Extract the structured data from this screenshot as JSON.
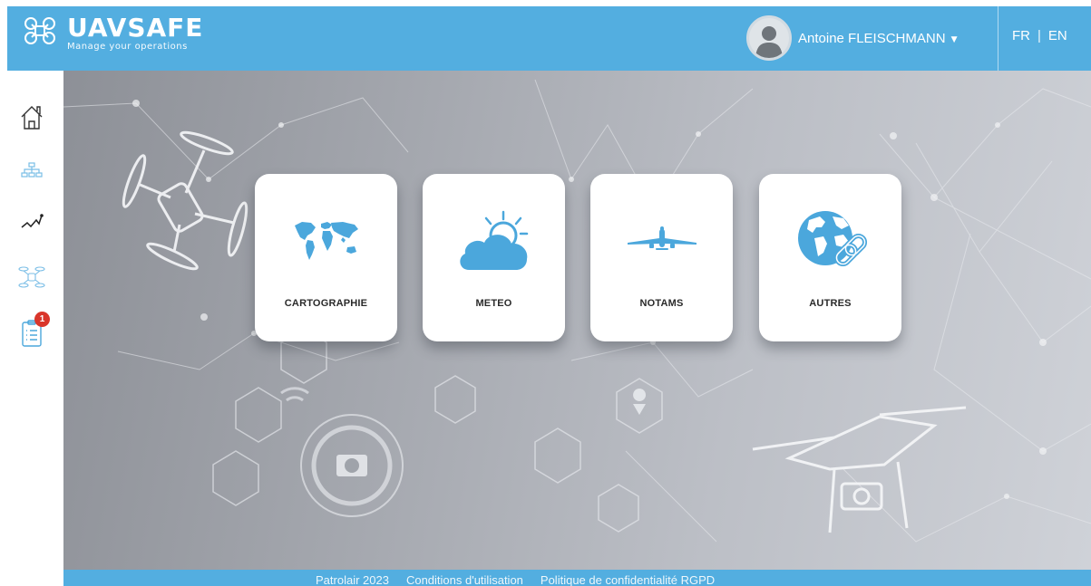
{
  "header": {
    "brand_name": "UAVSAFE",
    "brand_tagline": "Manage your operations",
    "user_name": "Antoine FLEISCHMANN",
    "lang_fr": "FR",
    "lang_sep": "|",
    "lang_en": "EN"
  },
  "sidebar": {
    "items": [
      {
        "icon": "home-icon"
      },
      {
        "icon": "hierarchy-icon"
      },
      {
        "icon": "chart-line-icon"
      },
      {
        "icon": "drone-icon"
      },
      {
        "icon": "checklist-icon",
        "badge": "1"
      }
    ]
  },
  "tiles": [
    {
      "label": "CARTOGRAPHIE",
      "icon": "world-map-icon"
    },
    {
      "label": "METEO",
      "icon": "cloud-sun-icon"
    },
    {
      "label": "NOTAMS",
      "icon": "airplane-icon"
    },
    {
      "label": "AUTRES",
      "icon": "globe-link-icon"
    }
  ],
  "footer": {
    "copyright": "Patrolair 2023",
    "terms": "Conditions d'utilisation",
    "privacy": "Politique de confidentialité RGPD"
  },
  "colors": {
    "accent": "#53aee0",
    "badge": "#d9362b",
    "icon_blue": "#4ba7dc"
  }
}
